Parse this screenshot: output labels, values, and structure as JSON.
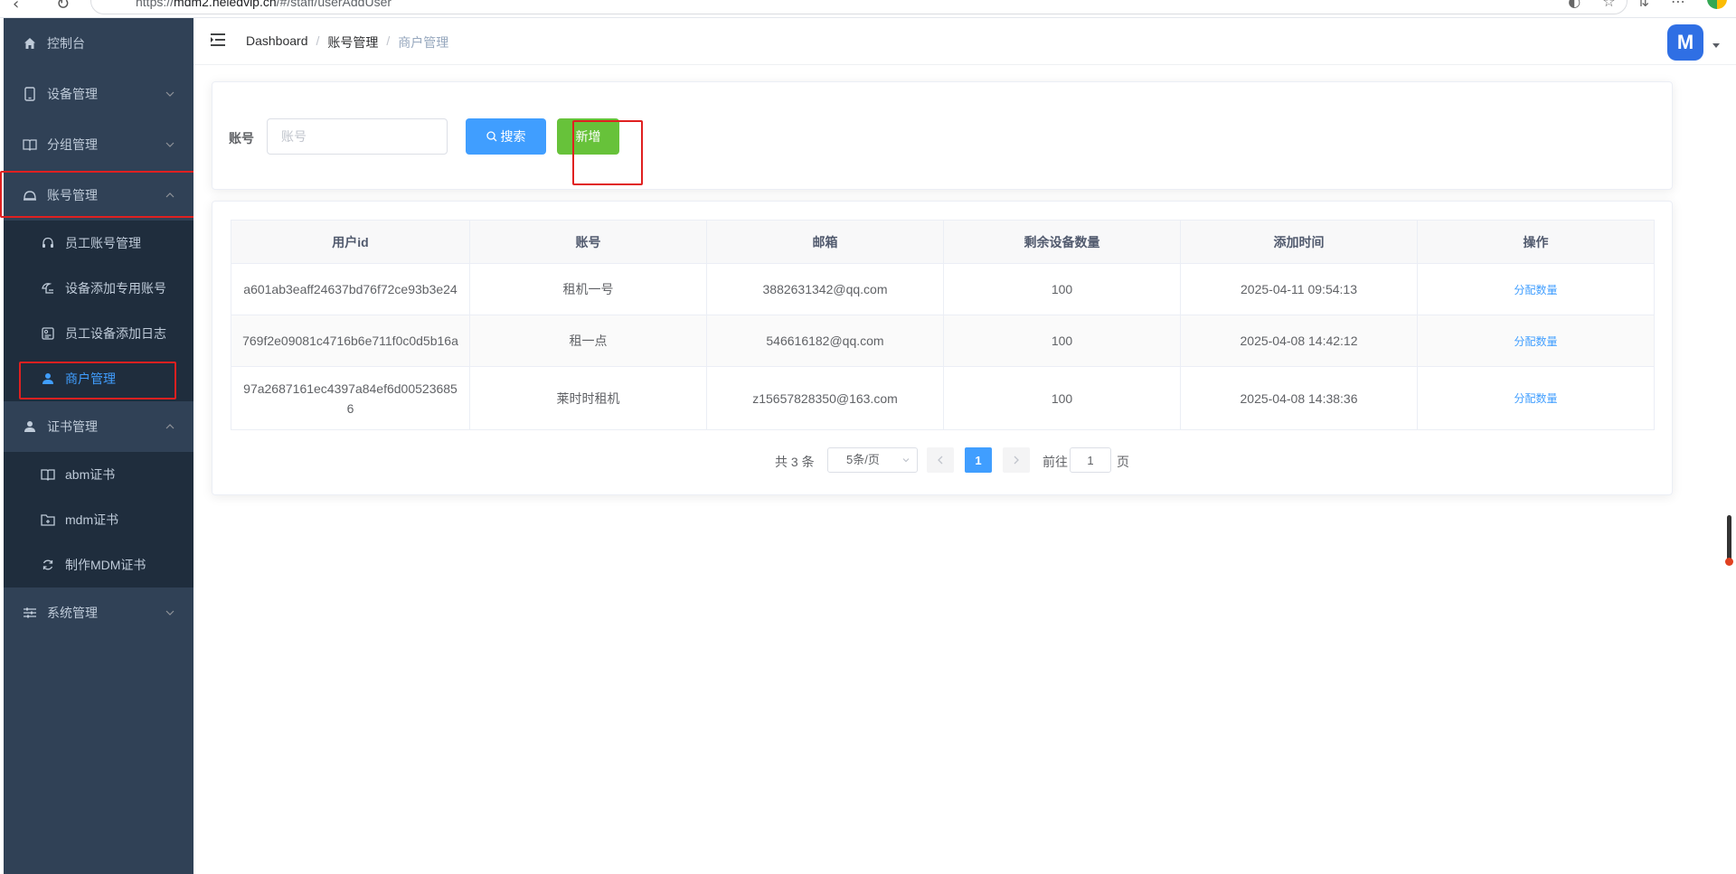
{
  "browser": {
    "url_prefix": "https://",
    "url_host": "mdm2.heledvip.cn",
    "url_path": "/#/staff/userAddUser"
  },
  "sidebar": {
    "items": [
      {
        "label": "控制台",
        "icon": "home-icon"
      },
      {
        "label": "设备管理",
        "icon": "tablet-icon"
      },
      {
        "label": "分组管理",
        "icon": "book-icon"
      },
      {
        "label": "账号管理",
        "icon": "bell-icon",
        "expanded": true
      },
      {
        "label": "证书管理",
        "icon": "user-icon",
        "expanded": true
      },
      {
        "label": "系统管理",
        "icon": "sliders-icon"
      }
    ],
    "account_sub": [
      {
        "label": "员工账号管理",
        "icon": "headset-icon"
      },
      {
        "label": "设备添加专用账号",
        "icon": "umbrella-icon"
      },
      {
        "label": "员工设备添加日志",
        "icon": "log-icon"
      },
      {
        "label": "商户管理",
        "icon": "user-fill-icon",
        "active": true
      }
    ],
    "cert_sub": [
      {
        "label": "abm证书",
        "icon": "book-icon"
      },
      {
        "label": "mdm证书",
        "icon": "folder-icon"
      },
      {
        "label": "制作MDM证书",
        "icon": "refresh-icon"
      }
    ]
  },
  "header": {
    "breadcrumb": [
      "Dashboard",
      "账号管理",
      "商户管理"
    ],
    "avatar_text": "M"
  },
  "search": {
    "label": "账号",
    "placeholder": "账号",
    "search_label": "搜索",
    "add_label": "新增"
  },
  "table": {
    "columns": [
      "用户id",
      "账号",
      "邮箱",
      "剩余设备数量",
      "添加时间",
      "操作"
    ],
    "rows": [
      {
        "id": "a601ab3eaff24637bd76f72ce93b3e24",
        "account": "租机一号",
        "email": "3882631342@qq.com",
        "remaining": "100",
        "time": "2025-04-11 09:54:13",
        "action": "分配数量"
      },
      {
        "id": "769f2e09081c4716b6e711f0c0d5b16a",
        "account": "租一点",
        "email": "546616182@qq.com",
        "remaining": "100",
        "time": "2025-04-08 14:42:12",
        "action": "分配数量"
      },
      {
        "id": "97a2687161ec4397a84ef6d005236856",
        "account": "莱时时租机",
        "email": "z15657828350@163.com",
        "remaining": "100",
        "time": "2025-04-08 14:38:36",
        "action": "分配数量"
      }
    ]
  },
  "pagination": {
    "total": "共 3 条",
    "page_size": "5条/页",
    "current": "1",
    "goto_label": "前往",
    "goto_value": "1",
    "page_suffix": "页"
  },
  "colors": {
    "sidebar_bg": "#304156",
    "primary": "#409eff",
    "success": "#67c23a",
    "highlight": "#e02020"
  }
}
